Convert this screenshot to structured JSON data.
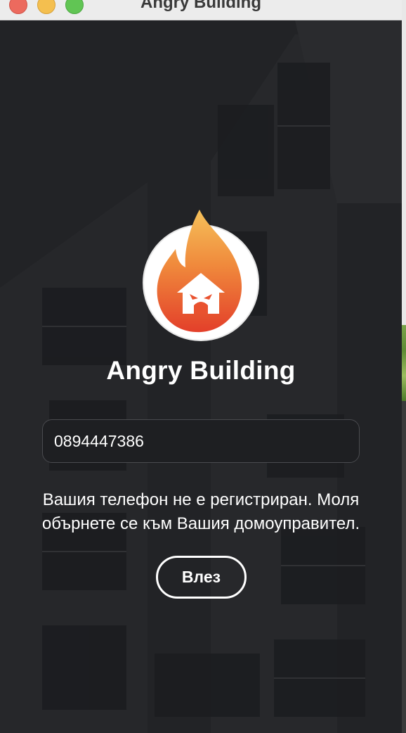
{
  "window": {
    "title": "Angry Building"
  },
  "app": {
    "name": "Angry Building"
  },
  "login": {
    "phone_value": "0894447386",
    "message_line1": "Вашия телефон не е регистриран. Моля",
    "message_line2": "обърнете се към Вашия домоуправител.",
    "button_label": "Влез"
  },
  "colors": {
    "background": "#222326",
    "text": "#ffffff",
    "logo_circle": "#ffffff",
    "flame_top": "#f5b04c",
    "flame_bottom": "#e4432b"
  }
}
